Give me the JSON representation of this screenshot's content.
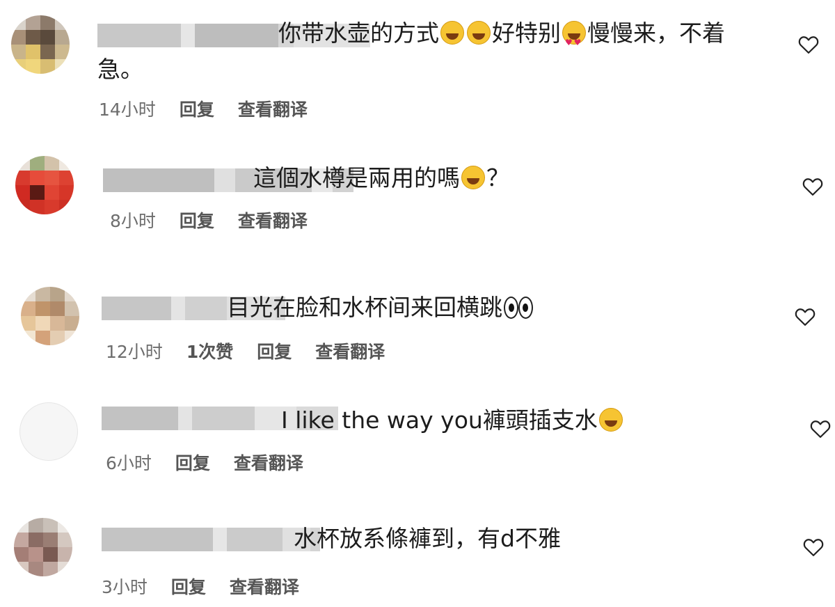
{
  "colors": {
    "text": "#1c1c1c",
    "meta": "#6d6d6d",
    "background": "#ffffff",
    "blur": "#cfcfcf"
  },
  "icons": {
    "like": "heart-outline-icon",
    "emoji_laugh": "face-with-tears-of-joy-icon",
    "emoji_love": "smiling-face-with-heart-eyes-icon",
    "emoji_eyes": "eyes-icon"
  },
  "comments": [
    {
      "text_parts": [
        "你带水壶的方式",
        "",
        "",
        "好特别",
        "",
        "慢慢来，不着"
      ],
      "text_line2": "急。",
      "time": "14小时",
      "reply": "回复",
      "translate": "查看翻译"
    },
    {
      "text_parts": [
        "這個水樽是兩用的嗎",
        "？"
      ],
      "time": "8小时",
      "reply": "回复",
      "translate": "查看翻译"
    },
    {
      "text_parts": [
        "目光在脸和水杯间来回横跳"
      ],
      "time": "12小时",
      "likes": "1次赞",
      "reply": "回复",
      "translate": "查看翻译"
    },
    {
      "text_parts": [
        "I like the way you褲頭插支水"
      ],
      "time": "6小时",
      "reply": "回复",
      "translate": "查看翻译"
    },
    {
      "text_parts": [
        "水杯放系條褲到，有d不雅"
      ],
      "time": "3小时",
      "reply": "回复",
      "translate": "查看翻译"
    }
  ]
}
